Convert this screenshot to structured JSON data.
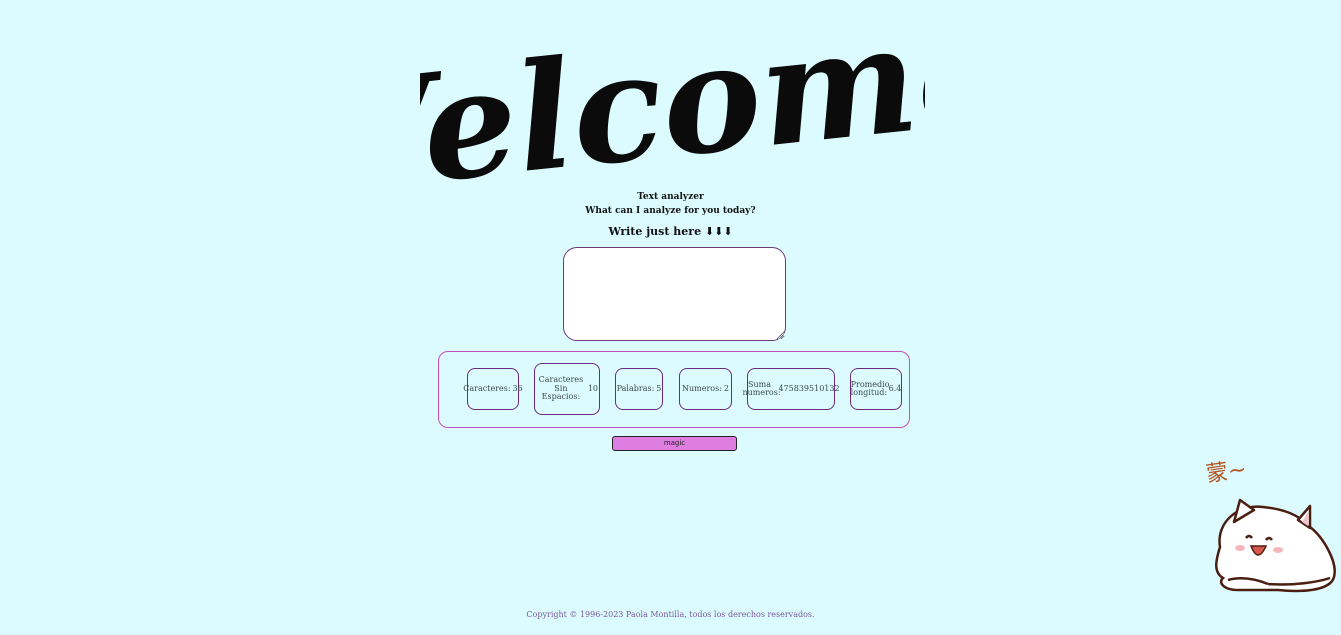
{
  "hero": {
    "welcome_text": "Welcome!"
  },
  "header": {
    "title": "Text analyzer",
    "question": "What can I analyze for you today?",
    "prompt": "Write just here ⬇⬇⬇"
  },
  "input": {
    "value": "",
    "placeholder": ""
  },
  "metrics": [
    {
      "label": "Caracteres:",
      "value": "36"
    },
    {
      "label": "Caracteres Sin Espacios:",
      "value": "10"
    },
    {
      "label": "Palabras:",
      "value": "5"
    },
    {
      "label": "Numeros:",
      "value": "2"
    },
    {
      "label": "Suma numeros:",
      "value": "475839510132"
    },
    {
      "label": "Promedio longitud:",
      "value": "6.4"
    }
  ],
  "actions": {
    "magic_label": "magic"
  },
  "sticker": {
    "caption": "蒙~"
  },
  "footer": {
    "copyright": "Copyright © 1996-2023 Paola Montilla, todos los derechos reservados."
  },
  "colors": {
    "background": "#dcfbff",
    "accent_border": "#c64fc0",
    "button": "#de7ee0",
    "metric_border": "#6b2a7a"
  }
}
